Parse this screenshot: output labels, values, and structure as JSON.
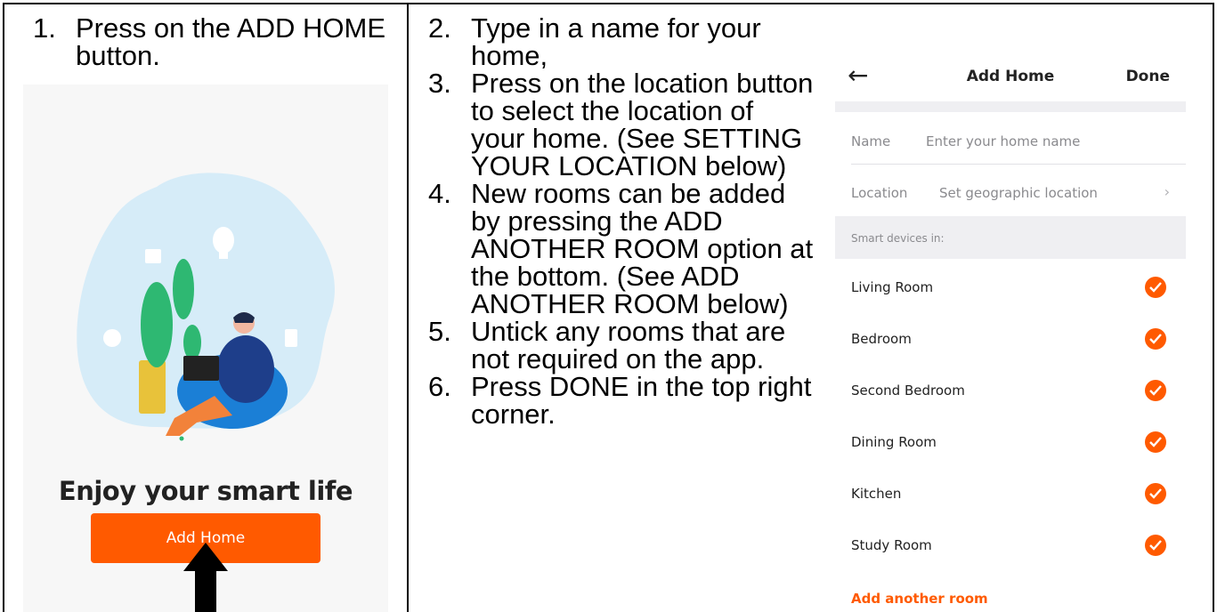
{
  "instructions_left": [
    {
      "num": "1.",
      "text": "Press on the ADD HOME button."
    }
  ],
  "instructions_mid": [
    {
      "num": "2.",
      "text": "Type in a name for your home,"
    },
    {
      "num": "3.",
      "text": "Press on the location button to select the location of your home. (See SETTING YOUR LOCATION below)"
    },
    {
      "num": "4.",
      "text": "New rooms can be added by pressing the ADD ANOTHER ROOM option at the bottom. (See ADD ANOTHER ROOM below)"
    },
    {
      "num": "5.",
      "text": "Untick any rooms that are not required on the app."
    },
    {
      "num": "6.",
      "text": "Press DONE in the top right corner."
    }
  ],
  "welcome_screen": {
    "heading": "Enjoy your smart life",
    "add_home_label": "Add Home"
  },
  "add_home_screen": {
    "title": "Add Home",
    "done_label": "Done",
    "name_label": "Name",
    "name_placeholder": "Enter your home name",
    "location_label": "Location",
    "location_placeholder": "Set geographic location",
    "section_label": "Smart devices in:",
    "rooms": [
      "Living Room",
      "Bedroom",
      "Second Bedroom",
      "Dining Room",
      "Kitchen",
      "Study Room"
    ],
    "add_room_label": "Add another room"
  },
  "colors": {
    "accent": "#ff5a00",
    "illustration_blob": "#d6ecf8"
  },
  "icons": [
    "back-arrow-icon",
    "chevron-right-icon",
    "check-icon",
    "black-arrow-up-icon"
  ]
}
